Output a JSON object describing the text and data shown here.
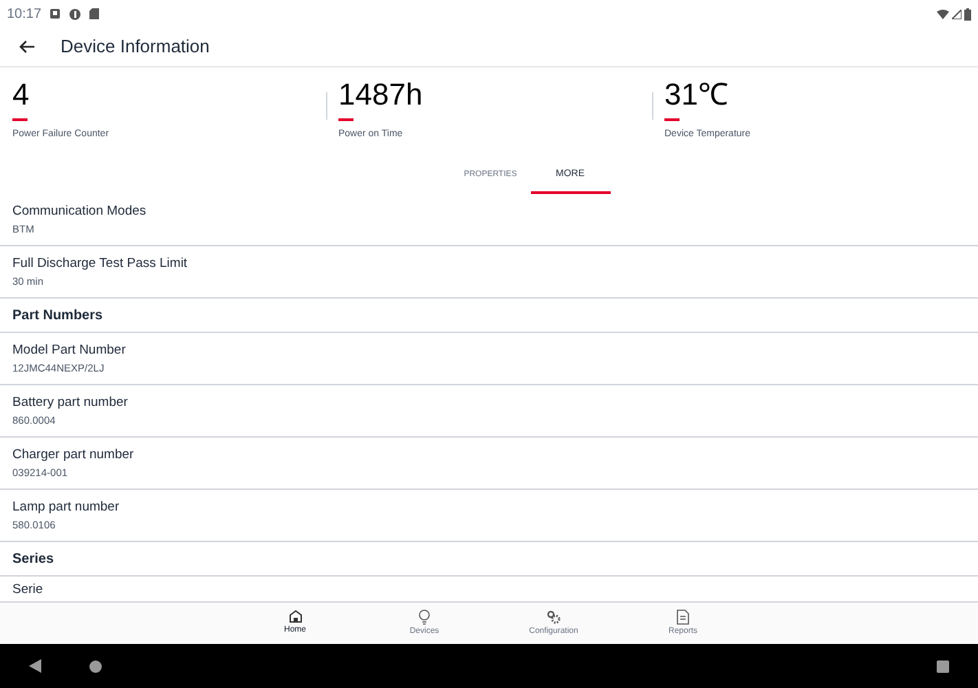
{
  "status_bar": {
    "time": "10:17"
  },
  "app_bar": {
    "title": "Device Information"
  },
  "stats": [
    {
      "value": "4",
      "label": "Power Failure Counter"
    },
    {
      "value": "1487h",
      "label": "Power on Time"
    },
    {
      "value": "31℃",
      "label": "Device Temperature"
    }
  ],
  "tabs": [
    {
      "label": "PROPERTIES",
      "selected": false
    },
    {
      "label": "MORE",
      "selected": true
    }
  ],
  "list": [
    {
      "kind": "field",
      "label": "Communication Modes",
      "value": "BTM"
    },
    {
      "kind": "field",
      "label": "Full Discharge Test Pass Limit",
      "value": "30 min"
    },
    {
      "kind": "header",
      "label": "Part Numbers"
    },
    {
      "kind": "field",
      "label": "Model Part Number",
      "value": "12JMC44NEXP/2LJ"
    },
    {
      "kind": "field",
      "label": "Battery part number",
      "value": "860.0004"
    },
    {
      "kind": "field",
      "label": "Charger part number",
      "value": "039214-001"
    },
    {
      "kind": "field",
      "label": "Lamp part number",
      "value": "580.0106"
    },
    {
      "kind": "header",
      "label": "Series"
    },
    {
      "kind": "field",
      "label": "Serie"
    }
  ],
  "bottom_nav": [
    {
      "label": "Home",
      "kind": "home",
      "selected": true
    },
    {
      "label": "Devices",
      "kind": "bulb",
      "selected": false
    },
    {
      "label": "Configuration",
      "kind": "gears",
      "selected": false
    },
    {
      "label": "Reports",
      "kind": "doc",
      "selected": false
    }
  ]
}
